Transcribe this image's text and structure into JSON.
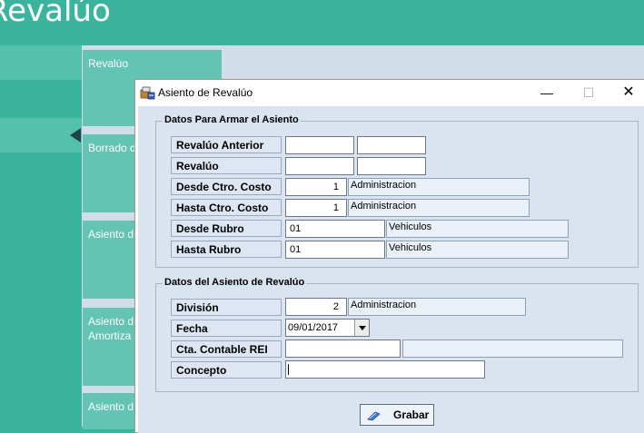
{
  "app": {
    "title": "Revalúo"
  },
  "tiles": [
    {
      "label": "Revalúo"
    },
    {
      "label": "Borrado d"
    },
    {
      "label": "Asiento d"
    },
    {
      "label": "Asiento d",
      "label2": "Amortiza"
    },
    {
      "label": "Asiento d"
    }
  ],
  "dialog": {
    "title": "Asiento de Revalúo",
    "minimize": "—",
    "maximize": "☐",
    "close": "✕",
    "group1": {
      "legend": "Datos Para Armar el Asiento",
      "rows": [
        {
          "label": "Revalúo Anterior",
          "value": "",
          "value2": ""
        },
        {
          "label": "Revalúo",
          "value": "",
          "value2": ""
        },
        {
          "label": "Desde Ctro. Costo",
          "value": "1",
          "desc": "Administracion"
        },
        {
          "label": "Hasta Ctro. Costo",
          "value": "1",
          "desc": "Administracion"
        },
        {
          "label": "Desde Rubro",
          "value": "01",
          "desc": "Vehiculos"
        },
        {
          "label": "Hasta Rubro",
          "value": "01",
          "desc": "Vehiculos"
        }
      ]
    },
    "group2": {
      "legend": "Datos del Asiento de Revalúo",
      "rows": [
        {
          "label": "División",
          "value": "2",
          "desc": "Administracion"
        },
        {
          "label": "Fecha",
          "value": "09/01/2017"
        },
        {
          "label": "Cta. Contable REI",
          "value": "",
          "desc": ""
        },
        {
          "label": "Concepto",
          "value": ""
        }
      ]
    },
    "save_label": "Grabar"
  },
  "colors": {
    "app_background": "#3bb49e",
    "tile": "#63c4b3",
    "content_background": "#d2ddea",
    "dialog_client": "#dae3f0"
  }
}
